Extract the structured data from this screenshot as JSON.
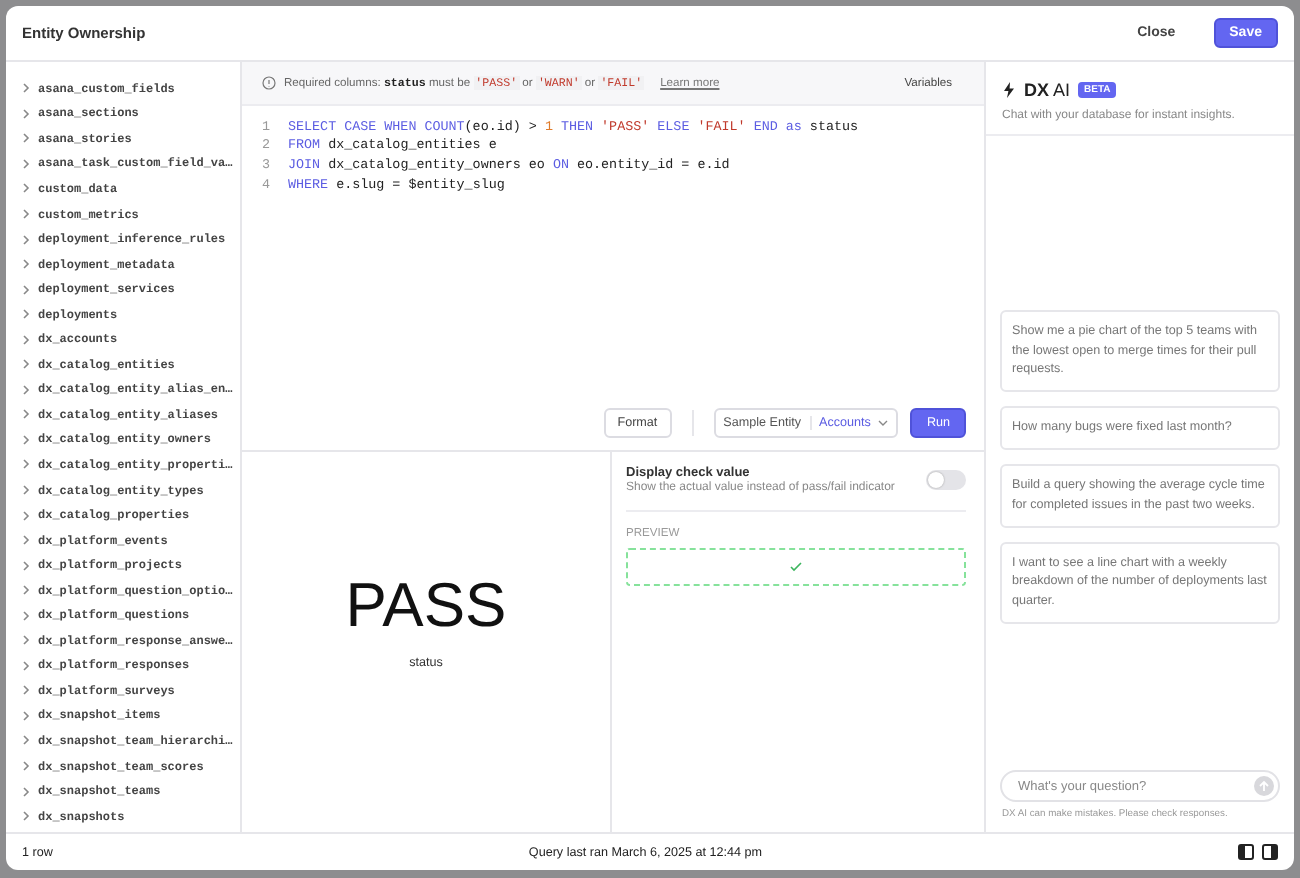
{
  "header": {
    "title": "Entity Ownership",
    "buttons": [
      {
        "label": "Close",
        "kind": "secondary"
      },
      {
        "label": "Save",
        "kind": "primary"
      }
    ]
  },
  "sidebar": {
    "tables": [
      "asana_custom_fields",
      "asana_sections",
      "asana_stories",
      "asana_task_custom_field_va…",
      "custom_data",
      "custom_metrics",
      "deployment_inference_rules",
      "deployment_metadata",
      "deployment_services",
      "deployments",
      "dx_accounts",
      "dx_catalog_entities",
      "dx_catalog_entity_alias_en…",
      "dx_catalog_entity_aliases",
      "dx_catalog_entity_owners",
      "dx_catalog_entity_properti…",
      "dx_catalog_entity_types",
      "dx_catalog_properties",
      "dx_platform_events",
      "dx_platform_projects",
      "dx_platform_question_optio…",
      "dx_platform_questions",
      "dx_platform_response_answe…",
      "dx_platform_responses",
      "dx_platform_surveys",
      "dx_snapshot_items",
      "dx_snapshot_team_hierarchi…",
      "dx_snapshot_team_scores",
      "dx_snapshot_teams",
      "dx_snapshots"
    ]
  },
  "editor": {
    "hint": {
      "segments": [
        {
          "kind": "text",
          "text": "Required columns: "
        },
        {
          "kind": "code",
          "text": "status"
        },
        {
          "kind": "text",
          "text": " must be "
        },
        {
          "kind": "string",
          "text": "'PASS'"
        },
        {
          "kind": "text",
          "text": " or "
        },
        {
          "kind": "string",
          "text": "'WARN'"
        },
        {
          "kind": "text",
          "text": " or "
        },
        {
          "kind": "string",
          "text": "'FAIL'"
        }
      ],
      "link": "Learn more"
    },
    "variables_button": "Variables",
    "lines": [
      {
        "number": "1",
        "tokens": [
          {
            "kind": "keyword",
            "text": "SELECT CASE WHEN COUNT"
          },
          {
            "kind": "plain",
            "text": "(eo.id) > "
          },
          {
            "kind": "number",
            "text": "1"
          },
          {
            "kind": "keyword",
            "text": " THEN "
          },
          {
            "kind": "string",
            "text": "'PASS'"
          },
          {
            "kind": "keyword",
            "text": " ELSE "
          },
          {
            "kind": "string",
            "text": "'FAIL'"
          },
          {
            "kind": "keyword",
            "text": " END as"
          },
          {
            "kind": "plain",
            "text": " status"
          }
        ]
      },
      {
        "number": "2",
        "tokens": [
          {
            "kind": "keyword",
            "text": "FROM"
          },
          {
            "kind": "plain",
            "text": " dx_catalog_entities e"
          }
        ]
      },
      {
        "number": "3",
        "tokens": [
          {
            "kind": "keyword",
            "text": "JOIN"
          },
          {
            "kind": "plain",
            "text": " dx_catalog_entity_owners eo "
          },
          {
            "kind": "keyword",
            "text": "ON"
          },
          {
            "kind": "plain",
            "text": " eo.entity_id = e.id"
          }
        ]
      },
      {
        "number": "4",
        "tokens": [
          {
            "kind": "keyword",
            "text": "WHERE"
          },
          {
            "kind": "plain",
            "text": " e.slug = $entity_slug"
          }
        ]
      }
    ],
    "format_button": "Format",
    "sample_entity": {
      "label": "Sample Entity",
      "value": "Accounts"
    },
    "run_button": "Run"
  },
  "result": {
    "value": "PASS",
    "column": "status"
  },
  "settings": {
    "title": "Display check value",
    "description": "Show the actual value instead of pass/fail indicator",
    "on": false,
    "preview_label": "PREVIEW"
  },
  "ai_panel": {
    "title": "**DX** AI",
    "badge": "BETA",
    "subtitle": "Chat with your database for instant insights.",
    "suggestions": [
      "Show me a pie chart of the top 5 teams with the lowest open to merge times for their pull requests.",
      "How many bugs were fixed last month?",
      "Build a query showing the average cycle time for completed issues in the past two weeks.",
      "I want to see a line chart with a weekly breakdown of the number of deployments last quarter."
    ],
    "input": {
      "placeholder": "What's your question?"
    },
    "disclaimer": "DX AI can make mistakes. Please check responses."
  },
  "footer": {
    "row_count": "1 row",
    "last_run": "Query last ran March 6, 2025 at 12:44 pm"
  }
}
